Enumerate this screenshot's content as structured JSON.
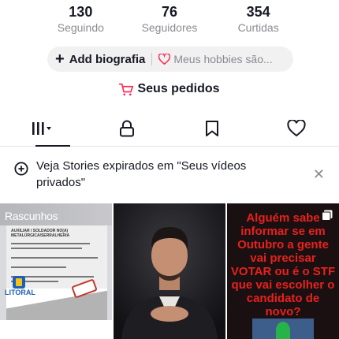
{
  "stats": [
    {
      "number": "130",
      "label": "Seguindo"
    },
    {
      "number": "76",
      "label": "Seguidores"
    },
    {
      "number": "354",
      "label": "Curtidas"
    }
  ],
  "bio": {
    "add_label": "Add biografia",
    "hobbies_placeholder": "Meus hobbies são..."
  },
  "orders": {
    "label": "Seus pedidos"
  },
  "tabs": [
    {
      "name": "videos-grid",
      "icon": "grid-icon",
      "active": true
    },
    {
      "name": "private",
      "icon": "lock-icon",
      "active": false
    },
    {
      "name": "saved",
      "icon": "bookmark-icon",
      "active": false
    },
    {
      "name": "liked",
      "icon": "heart-icon",
      "active": false
    }
  ],
  "banner": {
    "text": "Veja Stories expirados em \"Seus vídeos privados\""
  },
  "thumbnails": [
    {
      "draft_label": "Rascunhos",
      "flyer_title": "AUXILIAR / SOLDADOR NO(A) METALÚRGICA/SERRALHERIA",
      "logo_text": "LITORAL"
    },
    {
      "type": "portrait"
    },
    {
      "caption": "Alguém sabe informar se em Outubro a gente vai precisar VOTAR ou é o STF que vai escolher o candidato de novo?"
    }
  ],
  "colors": {
    "accent_red": "#fe2c55",
    "text_primary": "#161823",
    "text_secondary": "#8a8b91",
    "caption_red": "#e8211d"
  }
}
